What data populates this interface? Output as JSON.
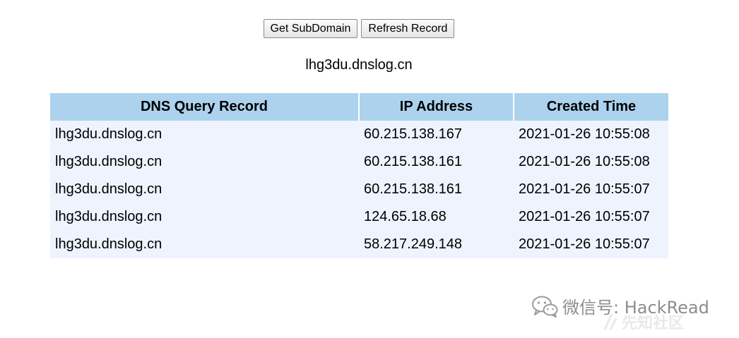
{
  "toolbar": {
    "get_subdomain_label": "Get SubDomain",
    "refresh_record_label": "Refresh Record"
  },
  "subdomain": "lhg3du.dnslog.cn",
  "table": {
    "headers": [
      "DNS Query Record",
      "IP Address",
      "Created Time"
    ],
    "rows": [
      [
        "lhg3du.dnslog.cn",
        "60.215.138.167",
        "2021-01-26 10:55:08"
      ],
      [
        "lhg3du.dnslog.cn",
        "60.215.138.161",
        "2021-01-26 10:55:08"
      ],
      [
        "lhg3du.dnslog.cn",
        "60.215.138.161",
        "2021-01-26 10:55:07"
      ],
      [
        "lhg3du.dnslog.cn",
        "124.65.18.68",
        "2021-01-26 10:55:07"
      ],
      [
        "lhg3du.dnslog.cn",
        "58.217.249.148",
        "2021-01-26 10:55:07"
      ]
    ]
  },
  "watermark": {
    "text": "微信号: HackRead",
    "background_text": "先知社区"
  },
  "colors": {
    "header_bg": "#acd2ee",
    "row_bg": "#eef3fe",
    "watermark": "#8d8d8d"
  }
}
